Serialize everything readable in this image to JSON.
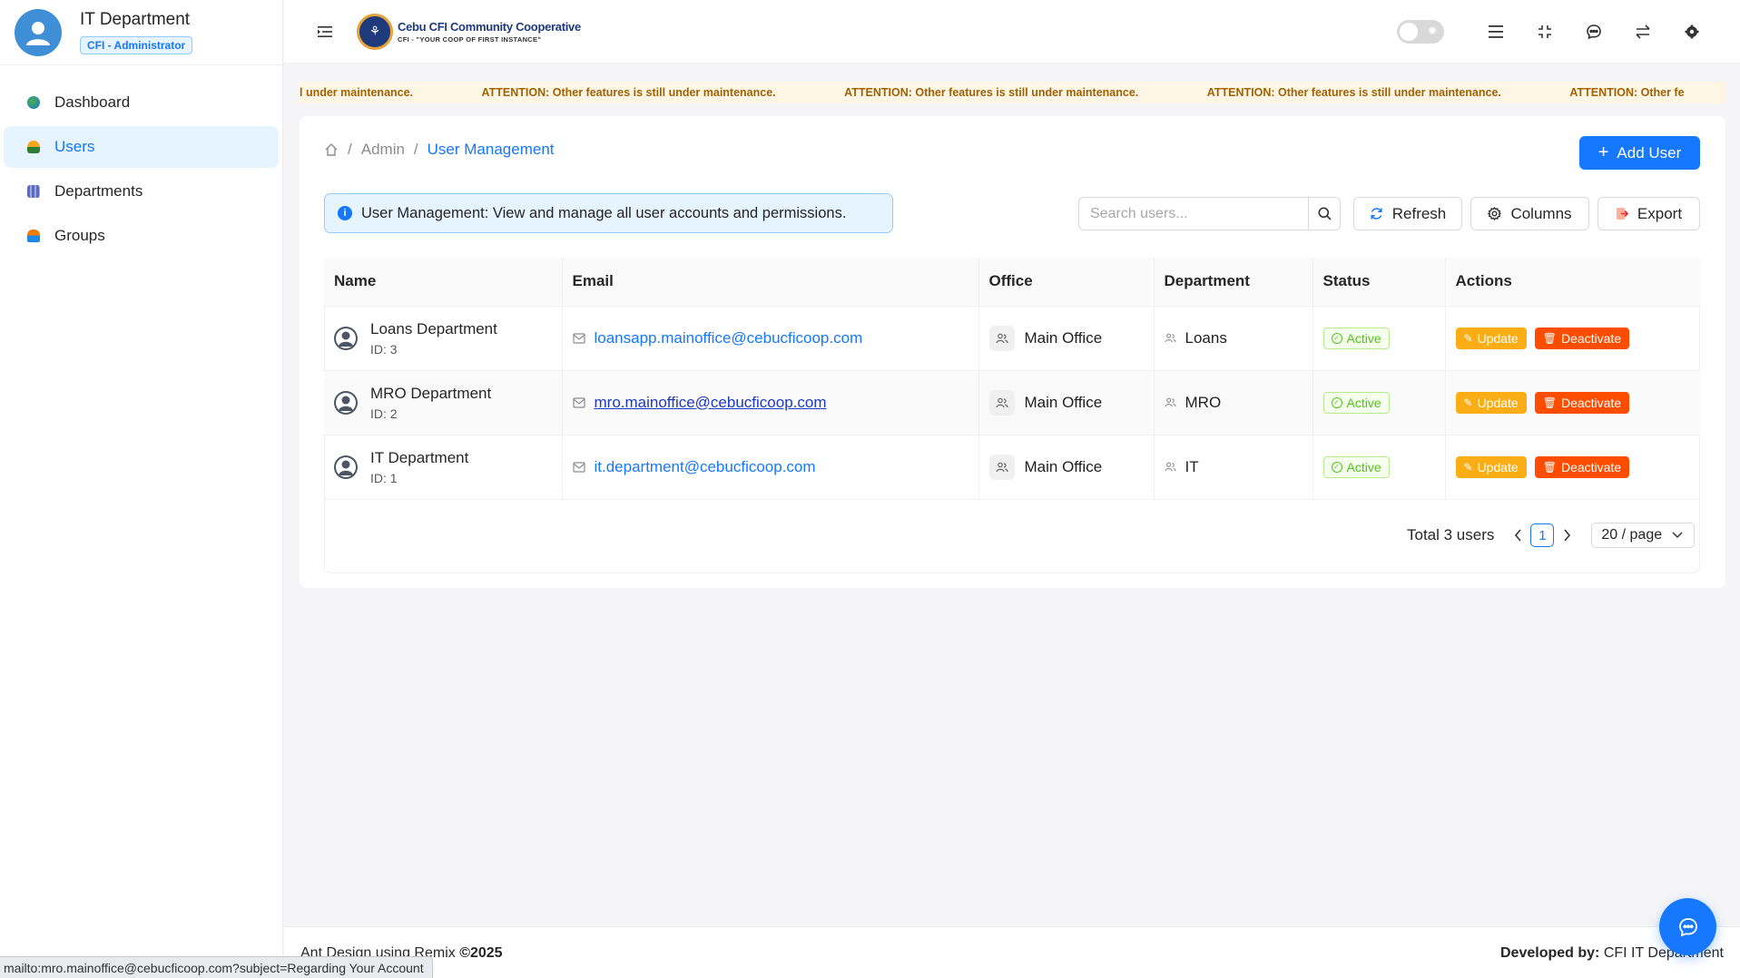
{
  "sidebar": {
    "profile_name": "IT Department",
    "role_badge": "CFI - Administrator",
    "items": [
      {
        "label": "Dashboard",
        "icon": "globe-icon",
        "active": false
      },
      {
        "label": "Users",
        "icon": "user-icon",
        "active": true
      },
      {
        "label": "Departments",
        "icon": "building-icon",
        "active": false
      },
      {
        "label": "Groups",
        "icon": "group-icon",
        "active": false
      }
    ]
  },
  "header": {
    "logo_title": "Cebu CFI Community Cooperative",
    "logo_subtitle": "CFI - \"YOUR COOP OF FIRST INSTANCE\"",
    "icons": [
      "menu-toggle-icon",
      "theme-toggle",
      "list-icon",
      "fullscreen-icon",
      "chat-icon",
      "swap-icon",
      "settings-icon"
    ]
  },
  "marquee": {
    "lead": "l under maintenance.",
    "message": "ATTENTION: Other features is still under maintenance.",
    "tail": "ATTENTION: Other fe"
  },
  "breadcrumb": {
    "home_icon": "home-icon",
    "admin": "Admin",
    "current": "User Management",
    "separator": "/"
  },
  "toolbar": {
    "add_user": "Add User",
    "info_text": "User Management: View and manage all user accounts and permissions.",
    "search_placeholder": "Search users...",
    "refresh": "Refresh",
    "columns": "Columns",
    "export": "Export"
  },
  "table": {
    "columns": [
      "Name",
      "Email",
      "Office",
      "Department",
      "Status",
      "Actions"
    ],
    "rows": [
      {
        "name": "Loans Department",
        "id": "ID: 3",
        "email": "loansapp.mainoffice@cebucficoop.com",
        "office": "Main Office",
        "department": "Loans",
        "status": "Active"
      },
      {
        "name": "MRO Department",
        "id": "ID: 2",
        "email": "mro.mainoffice@cebucficoop.com",
        "office": "Main Office",
        "department": "MRO",
        "status": "Active"
      },
      {
        "name": "IT Department",
        "id": "ID: 1",
        "email": "it.department@cebucficoop.com",
        "office": "Main Office",
        "department": "IT",
        "status": "Active"
      }
    ],
    "update_label": "Update",
    "deactivate_label": "Deactivate"
  },
  "pagination": {
    "total": "Total 3 users",
    "current_page": "1",
    "page_size": "20 / page"
  },
  "footer": {
    "left_text": "Ant Design using Remix ",
    "left_strong": "©2025",
    "right_strong": "Developed by: ",
    "right_text": "CFI IT Department"
  },
  "statusbar": {
    "url": "mailto:mro.mainoffice@cebucficoop.com?subject=Regarding Your Account"
  },
  "colors": {
    "primary": "#1677ff",
    "warning": "#faad14",
    "danger": "#ff4d00",
    "success": "#52c41a",
    "marquee_bg": "#fdf6e4"
  }
}
